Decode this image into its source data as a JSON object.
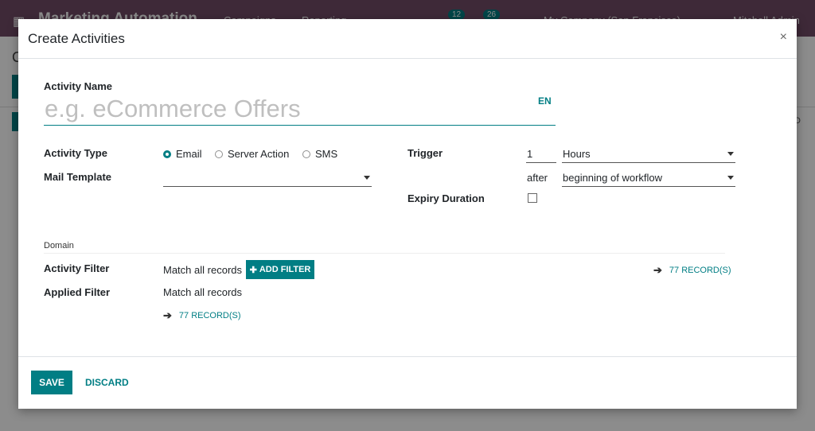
{
  "background": {
    "app_title": "Marketing Automation",
    "menu": [
      "Campaigns",
      "Reporting"
    ],
    "badge_messages": "12",
    "badge_activities": "26",
    "company": "My Company (San Francisco)",
    "user": "Mitchell Admin",
    "crumb": "C",
    "side_letter": "D"
  },
  "modal": {
    "title": "Create Activities",
    "close": "×",
    "activity_name": {
      "label": "Activity Name",
      "placeholder": "e.g. eCommerce Offers",
      "lang": "EN"
    },
    "activity_type": {
      "label": "Activity Type",
      "options": [
        "Email",
        "Server Action",
        "SMS"
      ],
      "selected": "Email"
    },
    "mail_template": {
      "label": "Mail Template",
      "value": ""
    },
    "trigger": {
      "label": "Trigger",
      "interval": "1",
      "unit": "Hours",
      "after_label": "after",
      "after_value": "beginning of workflow"
    },
    "expiry_duration": {
      "label": "Expiry Duration",
      "checked": false
    },
    "domain": {
      "section_label": "Domain",
      "activity_filter_label": "Activity Filter",
      "applied_filter_label": "Applied Filter",
      "match_prefix": "Match",
      "match_strong": "all records",
      "add_filter": "ADD FILTER",
      "records_right": "77 RECORD(S)",
      "records_left": "77 RECORD(S)"
    },
    "footer": {
      "save": "SAVE",
      "discard": "DISCARD"
    }
  },
  "colors": {
    "primary": "#017e84",
    "navbar": "#714B67"
  }
}
